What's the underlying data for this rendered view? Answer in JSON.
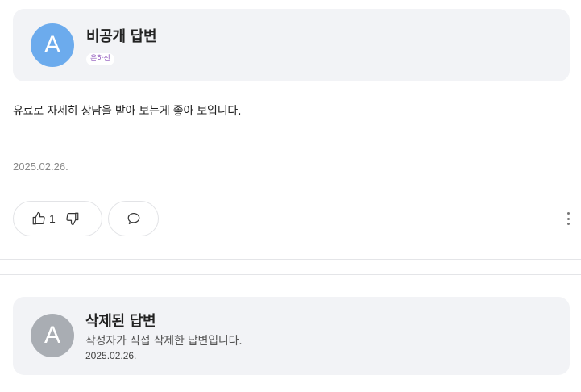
{
  "answer": {
    "avatar_letter": "A",
    "avatar_color": "#6cabed",
    "title": "비공개 답변",
    "badge": "은하신",
    "body": "유료로 자세히 상담을 받아 보는게 좋아 보입니다.",
    "date": "2025.02.26.",
    "like_count": "1",
    "icons": {
      "like": "thumbs-up-icon",
      "dislike": "thumbs-down-icon",
      "comment": "comment-bubble-icon",
      "more": "more-vertical-icon"
    }
  },
  "deleted_answer": {
    "avatar_letter": "A",
    "avatar_color": "#a9adb3",
    "title": "삭제된 답변",
    "description": "작성자가 직접 삭제한 답변입니다.",
    "date": "2025.02.26."
  }
}
